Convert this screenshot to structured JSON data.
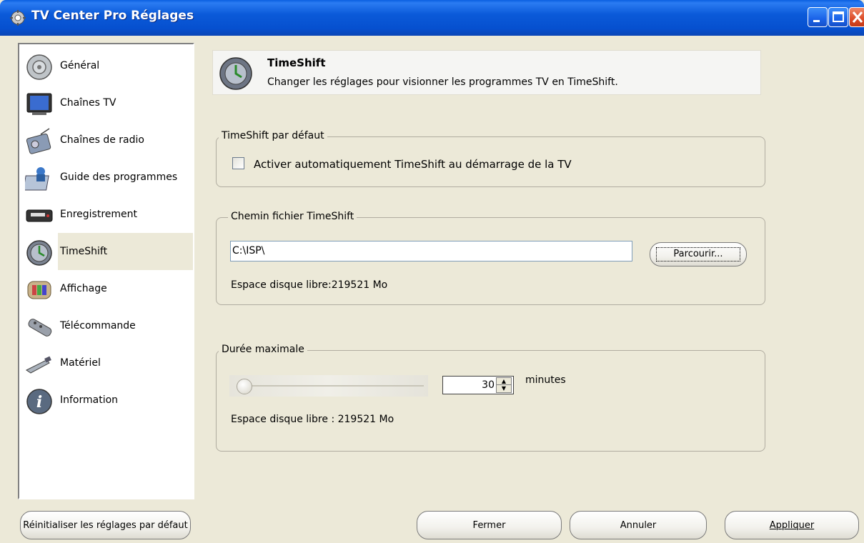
{
  "window": {
    "title": "TV Center Pro Réglages",
    "icon": "gear-icon"
  },
  "sidebar": {
    "items": [
      {
        "label": "Général",
        "icon": "speaker-icon"
      },
      {
        "label": "Chaînes TV",
        "icon": "tv-icon"
      },
      {
        "label": "Chaînes de radio",
        "icon": "radio-icon"
      },
      {
        "label": "Guide des programmes",
        "icon": "program-guide-icon"
      },
      {
        "label": "Enregistrement",
        "icon": "vcr-icon"
      },
      {
        "label": "TimeShift",
        "icon": "clock-icon",
        "selected": true
      },
      {
        "label": "Affichage",
        "icon": "display-icon"
      },
      {
        "label": "Télécommande",
        "icon": "remote-icon"
      },
      {
        "label": "Matériel",
        "icon": "hardware-icon"
      },
      {
        "label": "Information",
        "icon": "info-icon"
      }
    ]
  },
  "header": {
    "title": "TimeShift",
    "description": "Changer les réglages pour visionner les programmes TV en TimeShift."
  },
  "default_group": {
    "legend": "TimeShift par défaut",
    "checkbox_label": "Activer automatiquement TimeShift au démarrage de la TV",
    "checked": false
  },
  "path_group": {
    "legend": "Chemin fichier TimeShift",
    "path_value": "C:\\ISP\\",
    "browse_label": "Parcourir...",
    "free_space": "Espace disque libre:219521 Mo"
  },
  "duration_group": {
    "legend": "Durée maximale",
    "slider_level": 0.0,
    "spin_value": "30",
    "unit": "minutes",
    "free_space": "Espace disque libre : 219521 Mo"
  },
  "buttons": {
    "reset": "Réinitialiser les réglages par défaut",
    "close": "Fermer",
    "cancel": "Annuler",
    "apply": "Appliquer"
  },
  "colors": {
    "titlebar": "#0650cf",
    "dialog_bg": "#ece9d8",
    "selected_item": "#ece9d8"
  }
}
